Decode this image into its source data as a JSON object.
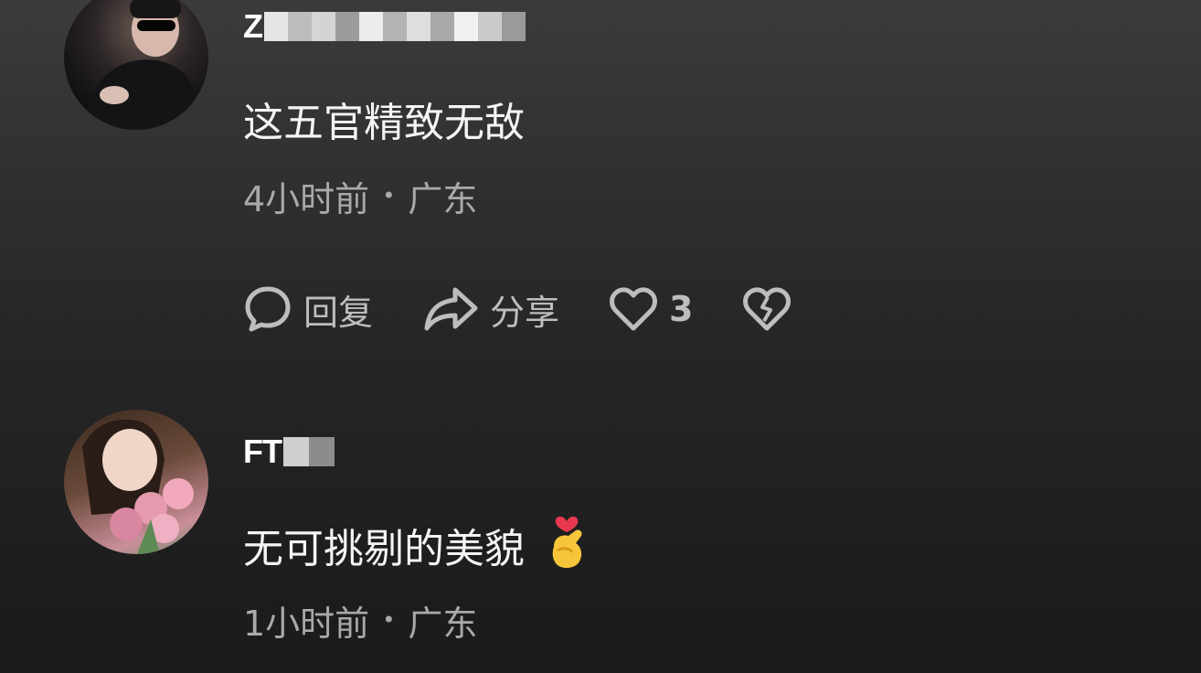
{
  "comments": [
    {
      "username_visible": "Z",
      "text": "这五官精致无敌",
      "time": "4小时前",
      "separator": "•",
      "location": "广东",
      "actions": {
        "reply_label": "回复",
        "share_label": "分享",
        "like_count": "3"
      }
    },
    {
      "username_visible": "FT",
      "text": "无可挑剔的美貌",
      "emoji": "🫰",
      "time": "1小时前",
      "separator": "•",
      "location": "广东"
    }
  ],
  "icons": [
    "comment-bubble-icon",
    "share-arrow-icon",
    "heart-icon",
    "broken-heart-icon",
    "finger-heart-emoji"
  ],
  "colors": {
    "background_top": "#3b3b3b",
    "background_bottom": "#1a1a1a",
    "text": "#f4f4f4",
    "meta": "#a9a9a9",
    "icon": "#bdbdbd"
  }
}
